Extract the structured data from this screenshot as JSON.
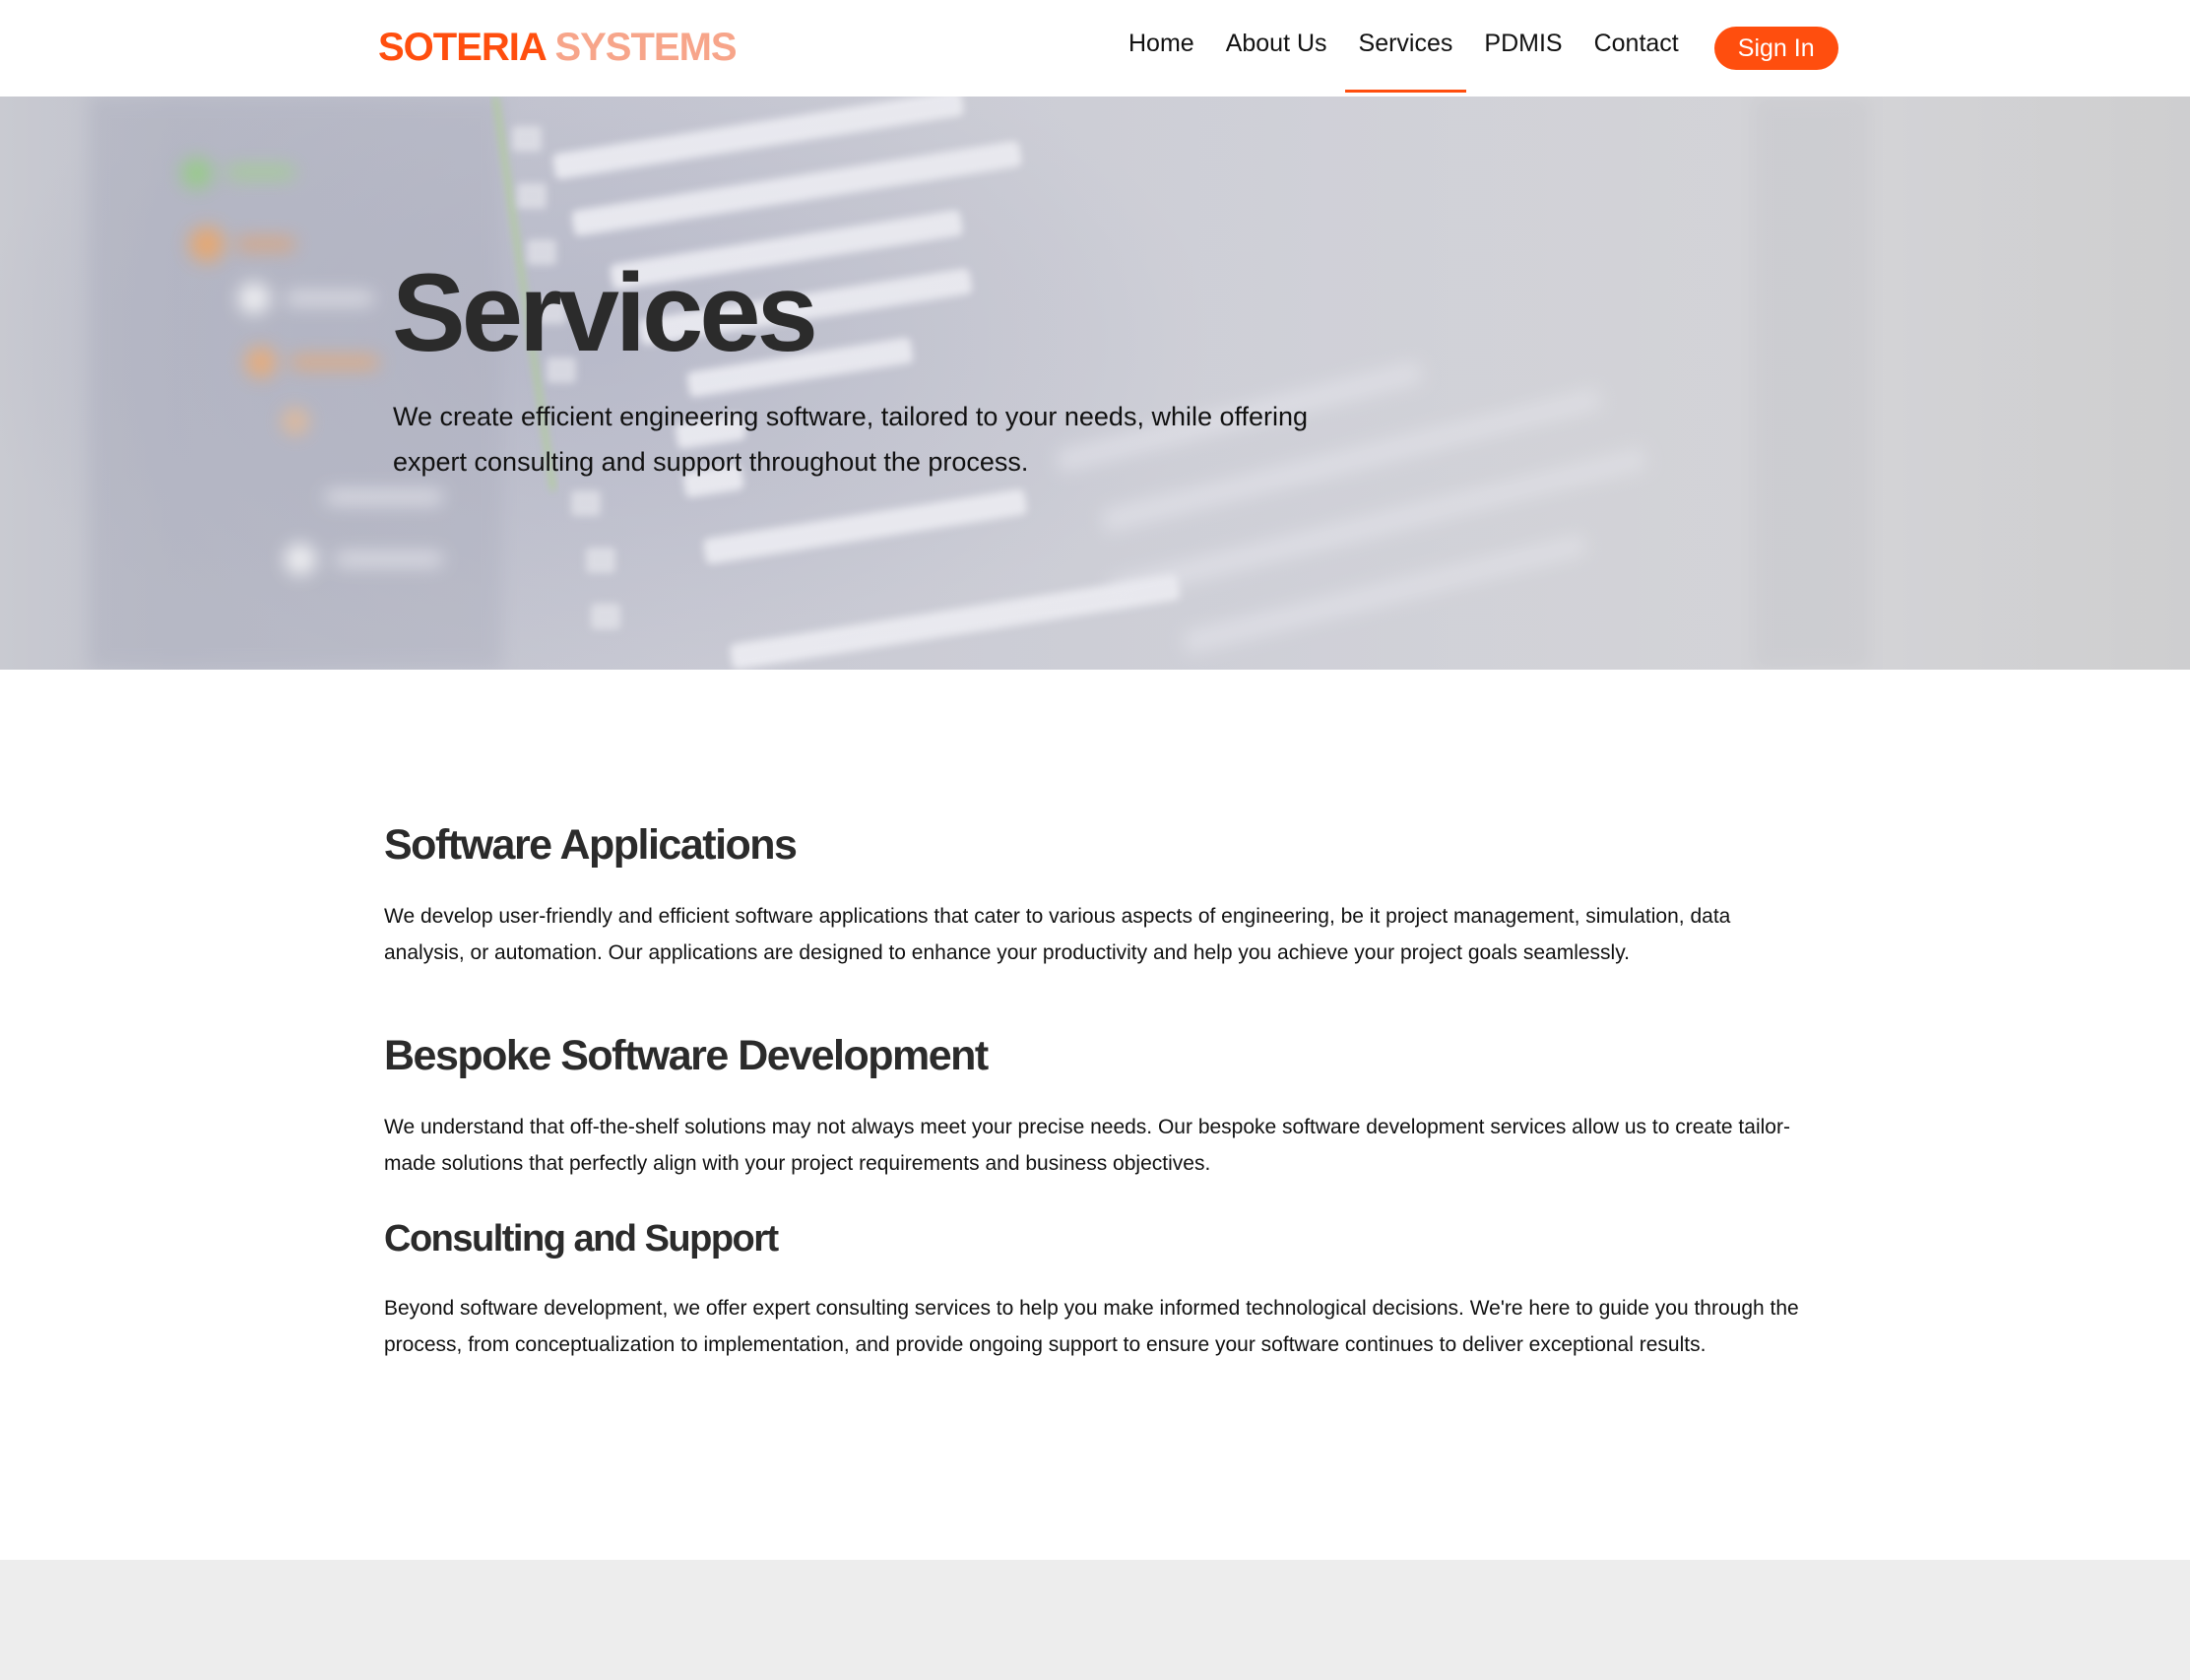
{
  "brand": {
    "part1": "SOTERIA",
    "part2": "SYSTEMS",
    "color_primary": "#ff4e0e",
    "color_secondary": "#f7a58a"
  },
  "nav": {
    "items": [
      {
        "label": "Home",
        "active": false
      },
      {
        "label": "About Us",
        "active": false
      },
      {
        "label": "Services",
        "active": true
      },
      {
        "label": "PDMIS",
        "active": false
      },
      {
        "label": "Contact",
        "active": false
      }
    ],
    "signin_label": "Sign In"
  },
  "hero": {
    "title": "Services",
    "subtitle": "We create efficient engineering software, tailored to your needs, while offering expert consulting and support throughout the process."
  },
  "sections": [
    {
      "heading": "Software Applications",
      "body": "We develop user-friendly and efficient software applications that cater to various aspects of engineering, be it project management, simulation, data analysis, or automation. Our applications are designed to enhance your productivity and help you achieve your project goals seamlessly."
    },
    {
      "heading": "Bespoke Software Development",
      "body": "We understand that off-the-shelf solutions may not always meet your precise needs. Our bespoke software development services allow us to create tailor-made solutions that perfectly align with your project requirements and business objectives."
    },
    {
      "heading": "Consulting and Support",
      "body": "Beyond software development, we offer expert consulting services to help you make informed technological decisions. We're here to guide you through the process, from conceptualization to implementation, and provide ongoing support to ensure your software continues to deliver exceptional results."
    }
  ]
}
